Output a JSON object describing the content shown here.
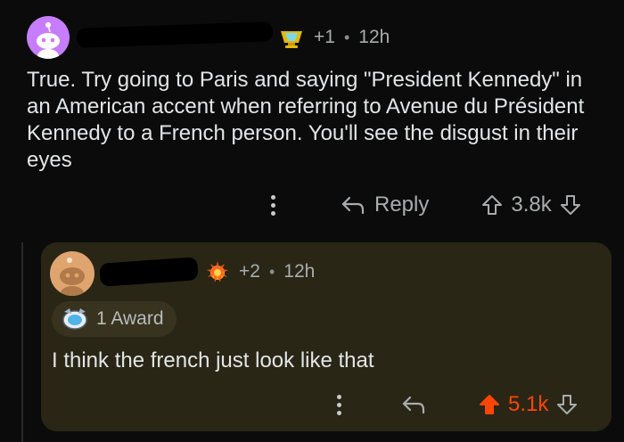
{
  "comment": {
    "award_count": "+1",
    "time": "12h",
    "body": "True. Try going to Paris and saying \"President Kennedy\" in an American accent when referring to Avenue du Président Kennedy to a French person. You'll see the disgust in their eyes",
    "reply_label": "Reply",
    "score": "3.8k"
  },
  "reply": {
    "award_count": "+2",
    "time": "12h",
    "award_pill_label": "1 Award",
    "body": "I think the french just look like that",
    "score": "5.1k"
  },
  "colors": {
    "background": "#0b0b0b",
    "card": "#2a2616",
    "upvote_active": "#ff4500",
    "avatar_top": "#c77dff",
    "avatar_reply": "#e0a56f"
  },
  "icons": [
    "snoo-avatar-icon",
    "award-trophy-icon",
    "award-fire-icon",
    "award-badge-icon",
    "kebab-menu-icon",
    "reply-arrow-icon",
    "upvote-icon",
    "downvote-icon"
  ]
}
